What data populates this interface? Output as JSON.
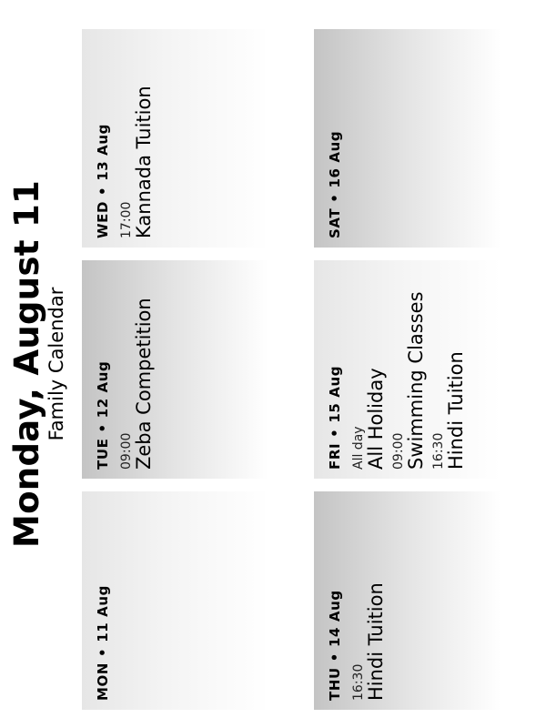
{
  "header": {
    "title": "Monday, August 11",
    "subtitle": "Family Calendar"
  },
  "days": [
    {
      "weekday": "MON",
      "separator": "•",
      "date": "11 Aug",
      "events": []
    },
    {
      "weekday": "TUE",
      "separator": "•",
      "date": "12 Aug",
      "events": [
        {
          "time": "09:00",
          "title": "Zeba Competition"
        }
      ]
    },
    {
      "weekday": "WED",
      "separator": "•",
      "date": "13 Aug",
      "events": [
        {
          "time": "17:00",
          "title": "Kannada Tuition"
        }
      ]
    },
    {
      "weekday": "THU",
      "separator": "•",
      "date": "14 Aug",
      "events": [
        {
          "time": "16:30",
          "title": "Hindi Tuition"
        }
      ]
    },
    {
      "weekday": "FRI",
      "separator": "•",
      "date": "15 Aug",
      "events": [
        {
          "time": "All day",
          "title": "All Holiday"
        },
        {
          "time": "09:00",
          "title": "Swimming Classes"
        },
        {
          "time": "16:30",
          "title": "Hindi Tuition"
        }
      ]
    },
    {
      "weekday": "SAT",
      "separator": "•",
      "date": "16 Aug",
      "events": []
    }
  ]
}
